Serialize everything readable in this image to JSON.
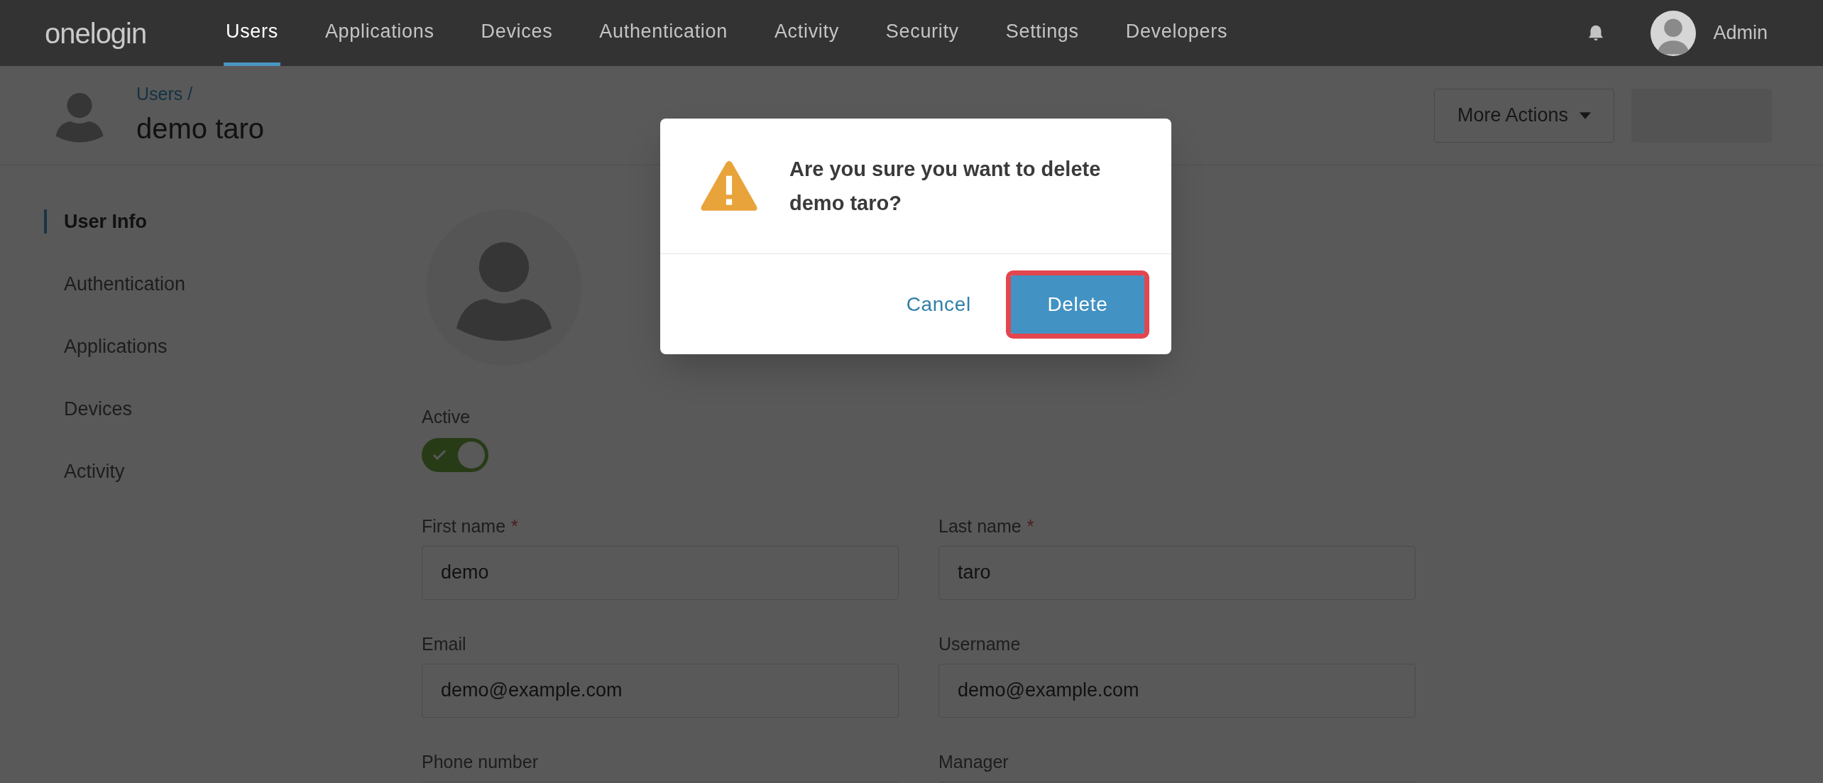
{
  "nav": {
    "logo": "onelogin",
    "items": [
      {
        "label": "Users",
        "selected": true
      },
      {
        "label": "Applications",
        "selected": false
      },
      {
        "label": "Devices",
        "selected": false
      },
      {
        "label": "Authentication",
        "selected": false
      },
      {
        "label": "Activity",
        "selected": false
      },
      {
        "label": "Security",
        "selected": false
      },
      {
        "label": "Settings",
        "selected": false
      },
      {
        "label": "Developers",
        "selected": false
      }
    ],
    "user": "Admin"
  },
  "header": {
    "breadcrumb": "Users /",
    "title": "demo taro",
    "more_actions": "More Actions"
  },
  "sidebar": {
    "items": [
      {
        "label": "User Info",
        "selected": true
      },
      {
        "label": "Authentication",
        "selected": false
      },
      {
        "label": "Applications",
        "selected": false
      },
      {
        "label": "Devices",
        "selected": false
      },
      {
        "label": "Activity",
        "selected": false
      }
    ]
  },
  "form": {
    "active": {
      "label": "Active",
      "on": true
    },
    "fields": [
      {
        "label": "First name",
        "required_mark": "*",
        "value": "demo"
      },
      {
        "label": "Last name",
        "required_mark": "*",
        "value": "taro"
      },
      {
        "label": "Email",
        "value": "demo@example.com"
      },
      {
        "label": "Username",
        "value": "demo@example.com"
      },
      {
        "label": "Phone number"
      },
      {
        "label": "Manager"
      }
    ]
  },
  "dialog": {
    "message": "Are you sure you want to delete demo taro?",
    "cancel": "Cancel",
    "delete": "Delete",
    "delete_highlighted": true
  }
}
